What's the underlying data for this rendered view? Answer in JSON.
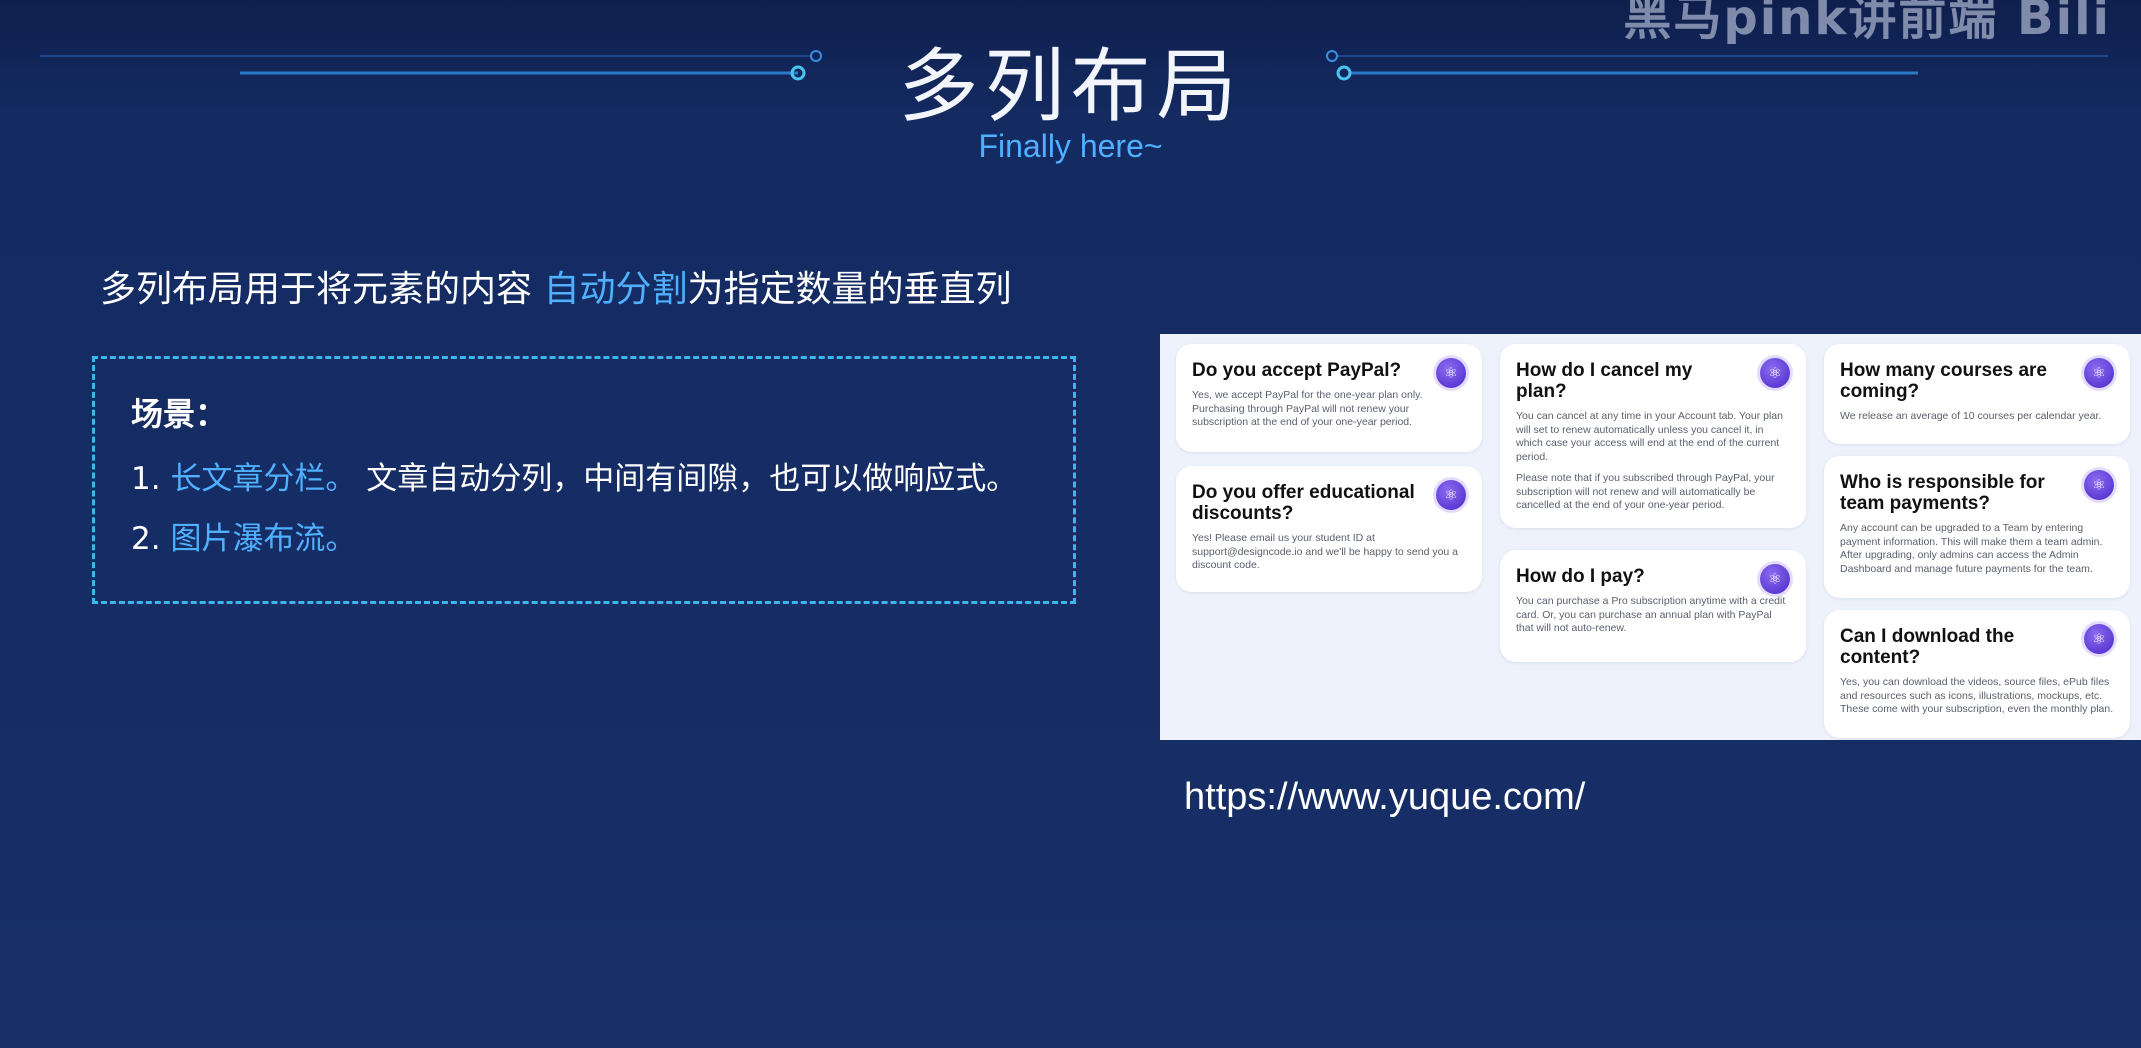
{
  "watermark": "黑马pink讲前端 Bili",
  "title": "多列布局",
  "subtitle": "Finally here~",
  "intro": {
    "before": "多列布局用于将元素的内容 ",
    "highlight": "自动分割",
    "after": "为指定数量的垂直列"
  },
  "scene": {
    "label": "场景：",
    "items": [
      {
        "num": "1. ",
        "highlight": "长文章分栏。",
        "rest": " 文章自动分列，中间有间隙，也可以做响应式。"
      },
      {
        "num": "2. ",
        "highlight": "图片瀑布流。",
        "rest": ""
      }
    ]
  },
  "faq_cards": [
    {
      "title": "Do you accept PayPal?",
      "text": "Yes, we accept PayPal for the one-year plan only. Purchasing through PayPal will not renew your subscription at the end of your one-year period."
    },
    {
      "title": "Do you offer educational discounts?",
      "text": "Yes! Please email us your student ID at support@designcode.io and we'll be happy to send you a discount code."
    },
    {
      "title": "How do I cancel my plan?",
      "text": "You can cancel at any time in your Account tab. Your plan will set to renew automatically unless you cancel it, in which case your access will end at the end of the current period.",
      "text2": "Please note that if you subscribed through PayPal, your subscription will not renew and will automatically be cancelled at the end of your one-year period."
    },
    {
      "title": "How do I pay?",
      "text": "You can purchase a Pro subscription anytime with a credit card. Or, you can purchase an annual plan with PayPal that will not auto-renew."
    },
    {
      "title": "How many courses are coming?",
      "text": "We release an average of 10 courses per calendar year."
    },
    {
      "title": "Who is responsible for team payments?",
      "text": "Any account can be upgraded to a Team by entering payment information. This will make them a team admin. After upgrading, only admins can access the Admin Dashboard and manage future payments for the team."
    },
    {
      "title": "Can I download the content?",
      "text": "Yes, you can download the videos, source files, ePub files and resources such as icons, illustrations, mockups, etc. These come with your subscription, even the monthly plan."
    }
  ],
  "badge_icon": "react-logo-icon",
  "url": "https://www.yuque.com/",
  "colors": {
    "background": "#172e66",
    "highlight": "#4fb0ff",
    "dashed_border": "#3db7ea"
  }
}
